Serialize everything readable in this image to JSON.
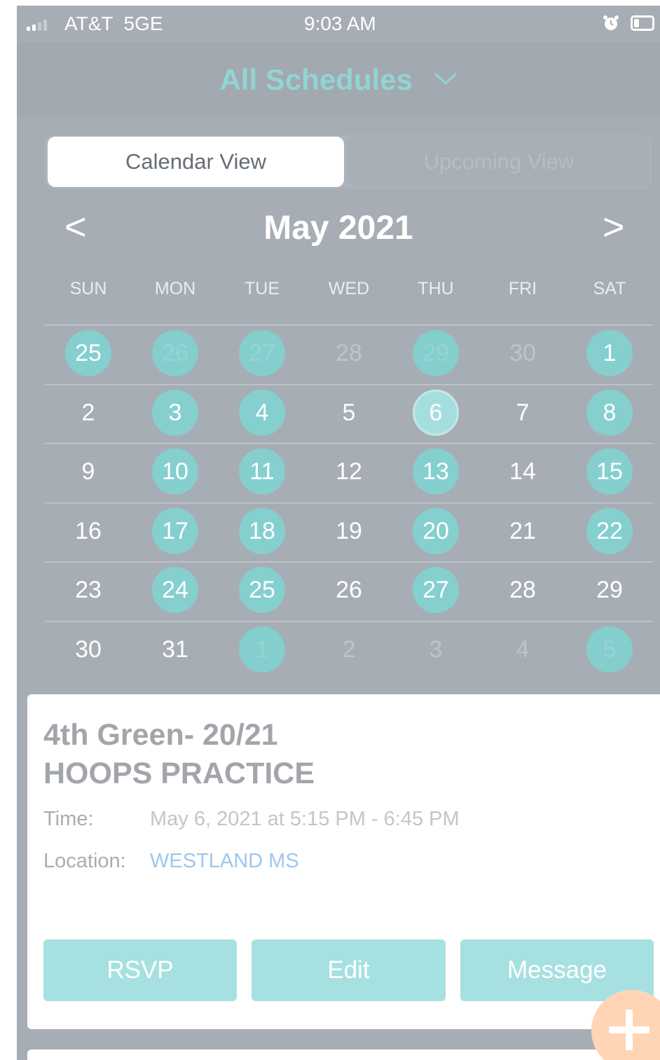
{
  "status_bar": {
    "carrier": "AT&T  5GE",
    "time": "9:03 AM",
    "signal_bars": 2,
    "icons": [
      "signal-icon",
      "alarm-icon",
      "battery-icon"
    ]
  },
  "header": {
    "title": "All Schedules",
    "dropdown_icon": "chevron-down-icon"
  },
  "view_toggle": {
    "active": "Calendar View",
    "inactive": "Upcoming View"
  },
  "calendar": {
    "month_label": "May 2021",
    "prev_label": "<",
    "next_label": ">",
    "weekdays": [
      "SUN",
      "MON",
      "TUE",
      "WED",
      "THU",
      "FRI",
      "SAT"
    ],
    "weeks": [
      [
        {
          "d": "25",
          "s": "event"
        },
        {
          "d": "26",
          "s": "event-out"
        },
        {
          "d": "27",
          "s": "event-out"
        },
        {
          "d": "28",
          "s": "dim"
        },
        {
          "d": "29",
          "s": "event-out"
        },
        {
          "d": "30",
          "s": "dim"
        },
        {
          "d": "1",
          "s": "event"
        }
      ],
      [
        {
          "d": "2",
          "s": "plain"
        },
        {
          "d": "3",
          "s": "event"
        },
        {
          "d": "4",
          "s": "event"
        },
        {
          "d": "5",
          "s": "plain"
        },
        {
          "d": "6",
          "s": "selected"
        },
        {
          "d": "7",
          "s": "plain"
        },
        {
          "d": "8",
          "s": "event"
        }
      ],
      [
        {
          "d": "9",
          "s": "plain"
        },
        {
          "d": "10",
          "s": "event"
        },
        {
          "d": "11",
          "s": "event"
        },
        {
          "d": "12",
          "s": "plain"
        },
        {
          "d": "13",
          "s": "event"
        },
        {
          "d": "14",
          "s": "plain"
        },
        {
          "d": "15",
          "s": "event"
        }
      ],
      [
        {
          "d": "16",
          "s": "plain"
        },
        {
          "d": "17",
          "s": "event"
        },
        {
          "d": "18",
          "s": "event"
        },
        {
          "d": "19",
          "s": "plain"
        },
        {
          "d": "20",
          "s": "event"
        },
        {
          "d": "21",
          "s": "plain"
        },
        {
          "d": "22",
          "s": "event"
        }
      ],
      [
        {
          "d": "23",
          "s": "plain"
        },
        {
          "d": "24",
          "s": "event"
        },
        {
          "d": "25",
          "s": "event"
        },
        {
          "d": "26",
          "s": "plain"
        },
        {
          "d": "27",
          "s": "event"
        },
        {
          "d": "28",
          "s": "plain"
        },
        {
          "d": "29",
          "s": "plain"
        }
      ],
      [
        {
          "d": "30",
          "s": "plain"
        },
        {
          "d": "31",
          "s": "plain"
        },
        {
          "d": "1",
          "s": "event-out"
        },
        {
          "d": "2",
          "s": "dim"
        },
        {
          "d": "3",
          "s": "dim"
        },
        {
          "d": "4",
          "s": "dim"
        },
        {
          "d": "5",
          "s": "event-out"
        }
      ]
    ]
  },
  "event": {
    "team": "4th Green- 20/21",
    "name": "HOOPS PRACTICE",
    "time_label": "Time:",
    "time_value": "May 6, 2021 at 5:15 PM - 6:45 PM",
    "location_label": "Location:",
    "location_value": "WESTLAND MS",
    "actions": {
      "rsvp": "RSVP",
      "edit": "Edit",
      "message": "Message"
    }
  },
  "fab": {
    "icon": "plus-icon"
  },
  "colors": {
    "accent": "#85cfcf",
    "fab": "#ffd5b5",
    "link": "#9fc7ec",
    "overlay": "#a7adb4"
  }
}
